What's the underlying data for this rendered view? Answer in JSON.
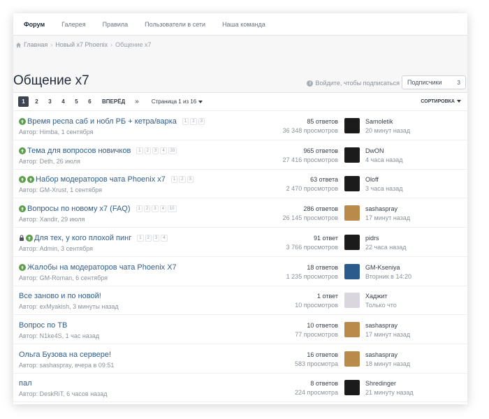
{
  "nav": {
    "tabs": [
      {
        "label": "Форум",
        "active": true
      },
      {
        "label": "Галерея"
      },
      {
        "label": "Правила"
      },
      {
        "label": "Пользователи в сети"
      },
      {
        "label": "Наша команда"
      }
    ]
  },
  "breadcrumb": {
    "items": [
      "Главная",
      "Новый x7 Phoenix",
      "Общение x7"
    ]
  },
  "page": {
    "title": "Общение x7",
    "subscribe_hint": "Войдите, чтобы подписаться",
    "followers_label": "Подписчики",
    "followers_count": "3"
  },
  "pagination": {
    "pages": [
      "1",
      "2",
      "3",
      "4",
      "5",
      "6"
    ],
    "next_label": "ВПЕРЁД",
    "last_label": "»",
    "page_info": "Страница 1 из 16",
    "sort_label": "СОРТИРОВКА"
  },
  "topics": [
    {
      "title": "Время респа саб и нобл РБ + кетра/варка",
      "pinned": true,
      "double_pin": false,
      "locked": false,
      "pages": [
        "1",
        "2",
        "3"
      ],
      "author": "Автор: Himba, 1 сентября",
      "replies": "85 ответов",
      "views": "36 348 просмотров",
      "last_user": "Samoletik",
      "last_time": "20 минут назад",
      "avatar_color": "#1b1b1b"
    },
    {
      "title": "Тема для вопросов новичков",
      "pinned": true,
      "double_pin": false,
      "locked": false,
      "pages": [
        "1",
        "2",
        "3",
        "4",
        "33"
      ],
      "author": "Автор: Deth, 26 июля",
      "replies": "965 ответов",
      "views": "27 416 просмотров",
      "last_user": "DwON",
      "last_time": "4 часа назад",
      "avatar_color": "#1b1b1b"
    },
    {
      "title": "Набор модераторов чата Phoenix x7",
      "pinned": true,
      "double_pin": true,
      "locked": false,
      "pages": [
        "1",
        "2",
        "3"
      ],
      "author": "Автор: GM-Xrust, 1 сентября",
      "replies": "63 ответа",
      "views": "2 470 просмотров",
      "last_user": "Oloff",
      "last_time": "3 часа назад",
      "avatar_color": "#1b1b1b"
    },
    {
      "title": "Вопросы по новому x7 (FAQ)",
      "pinned": true,
      "double_pin": false,
      "locked": false,
      "pages": [
        "1",
        "2",
        "3",
        "4",
        "10"
      ],
      "author": "Автор: Xandir, 29 июля",
      "replies": "286 ответов",
      "views": "26 145 просмотров",
      "last_user": "sashaspray",
      "last_time": "17 минут назад",
      "avatar_color": "#b98a4a"
    },
    {
      "title": "Для тех, у кого плохой пинг",
      "pinned": true,
      "double_pin": false,
      "locked": true,
      "pages": [
        "1",
        "2",
        "3",
        "4"
      ],
      "author": "Автор: Admin, 3 сентября",
      "replies": "91 ответ",
      "views": "3 766 просмотров",
      "last_user": "pidrs",
      "last_time": "22 часа назад",
      "avatar_color": "#1b1b1b"
    },
    {
      "title": "Жалобы на модераторов чата Phoenix X7",
      "pinned": true,
      "double_pin": false,
      "locked": false,
      "pages": [],
      "author": "Автор: GM-Roman, 6 сентября",
      "replies": "18 ответов",
      "views": "1 235 просмотров",
      "last_user": "GM-Kseniya",
      "last_time": "Вторник в 14:20",
      "avatar_color": "#2b5a8c"
    },
    {
      "title": "Все заново и по новой!",
      "pinned": false,
      "double_pin": false,
      "locked": false,
      "pages": [],
      "author": "Автор: exMyakish, 3 минуты назад",
      "replies": "1 ответ",
      "views": "10 просмотров",
      "last_user": "Хаджит",
      "last_time": "Только что",
      "avatar_color": "#d9d6dd"
    },
    {
      "title": "Вопрос по ТВ",
      "pinned": false,
      "double_pin": false,
      "locked": false,
      "pages": [],
      "author": "Автор: N1ke4S, 1 час назад",
      "replies": "10 ответов",
      "views": "77 просмотров",
      "last_user": "sashaspray",
      "last_time": "17 минут назад",
      "avatar_color": "#b98a4a"
    },
    {
      "title": "Ольга Бузова на сервере!",
      "pinned": false,
      "double_pin": false,
      "locked": false,
      "pages": [],
      "author": "Автор: sashaspray, вчера в 09:51",
      "replies": "16 ответов",
      "views": "583 просмотра",
      "last_user": "sashaspray",
      "last_time": "18 минут назад",
      "avatar_color": "#b98a4a"
    },
    {
      "title": "пал",
      "pinned": false,
      "double_pin": false,
      "locked": false,
      "pages": [],
      "author": "Автор: DeskRiT, 6 часов назад",
      "replies": "8 ответов",
      "views": "224 просмотра",
      "last_user": "Shredinger",
      "last_time": "21 минуту назад",
      "avatar_color": "#1b1b1b"
    }
  ]
}
